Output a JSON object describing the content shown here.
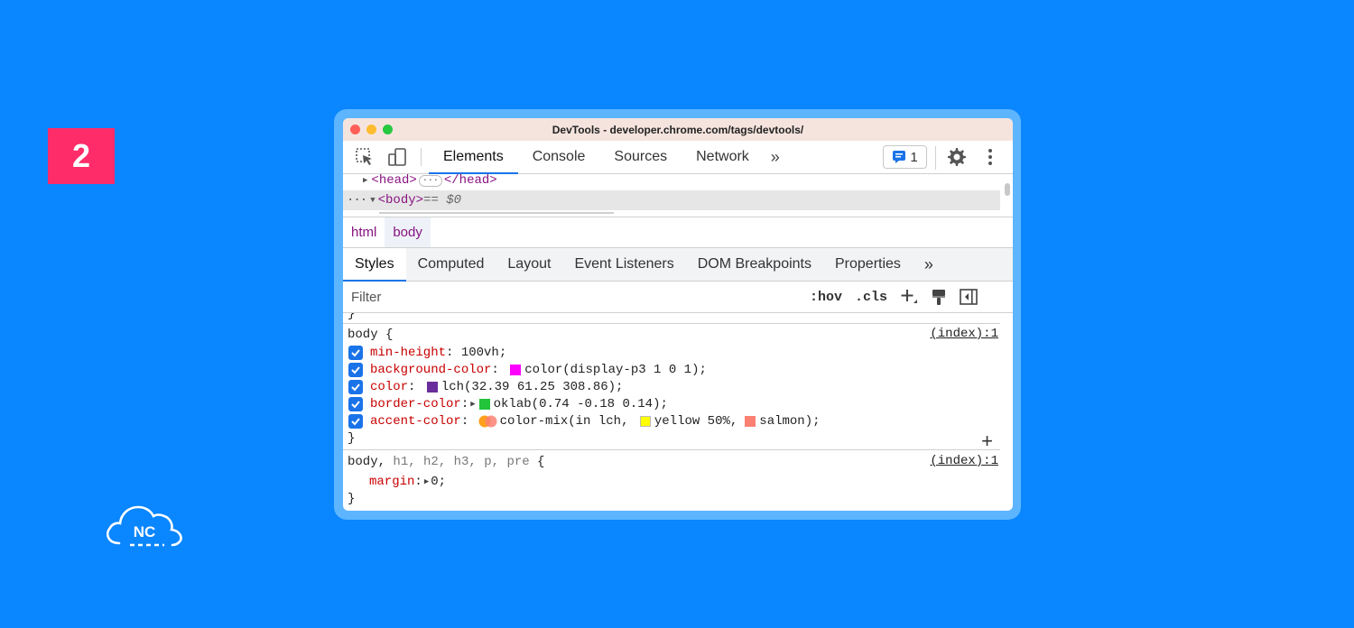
{
  "badge": {
    "number": "2"
  },
  "logo": {
    "text": "NC"
  },
  "window": {
    "title": "DevTools - developer.chrome.com/tags/devtools/",
    "tabs": [
      "Elements",
      "Console",
      "Sources",
      "Network"
    ],
    "active_tab": "Elements",
    "more": "»",
    "issues_count": "1"
  },
  "dom": {
    "head_open": "<head>",
    "head_ellipsis": "···",
    "head_close": "</head>",
    "dots": "···",
    "body_tag": "<body>",
    "body_suffix": " == $0"
  },
  "breadcrumbs": [
    "html",
    "body"
  ],
  "subtabs": [
    "Styles",
    "Computed",
    "Layout",
    "Event Listeners",
    "DOM Breakpoints",
    "Properties"
  ],
  "subtabs_more": "»",
  "filterbar": {
    "placeholder": "Filter",
    "hov": ":hov",
    "cls": ".cls"
  },
  "styles": {
    "rule1": {
      "selector": "body {",
      "source": "(index):1",
      "decls": [
        {
          "prop": "min-height",
          "value": "100vh;"
        },
        {
          "prop": "background-color",
          "value": "color(display-p3 1 0 1);",
          "swatch": "#FF00FF"
        },
        {
          "prop": "color",
          "value": "lch(32.39 61.25 308.86);",
          "swatch": "#6A2E9C"
        },
        {
          "prop": "border-color",
          "value": "oklab(0.74 -0.18 0.14);",
          "swatch": "#22C43A"
        },
        {
          "prop": "accent-color",
          "value_prefix": "color-mix(in lch, ",
          "yellow": "yellow 50%,",
          "salmon": "salmon);",
          "yellow_swatch": "#FFFF00",
          "salmon_swatch": "#FA8072"
        }
      ],
      "close": "}"
    },
    "rule2": {
      "selector_main": "body,",
      "selector_rest": " h1, h2, h3, p, pre",
      "brace": " {",
      "source": "(index):1",
      "decl_prop": "margin",
      "decl_value": "0;",
      "close": "}"
    },
    "top_brace": "}"
  },
  "colors": {
    "background": "#0A86FE",
    "badge": "#FF2C6A",
    "accent": "#1A73E8"
  }
}
